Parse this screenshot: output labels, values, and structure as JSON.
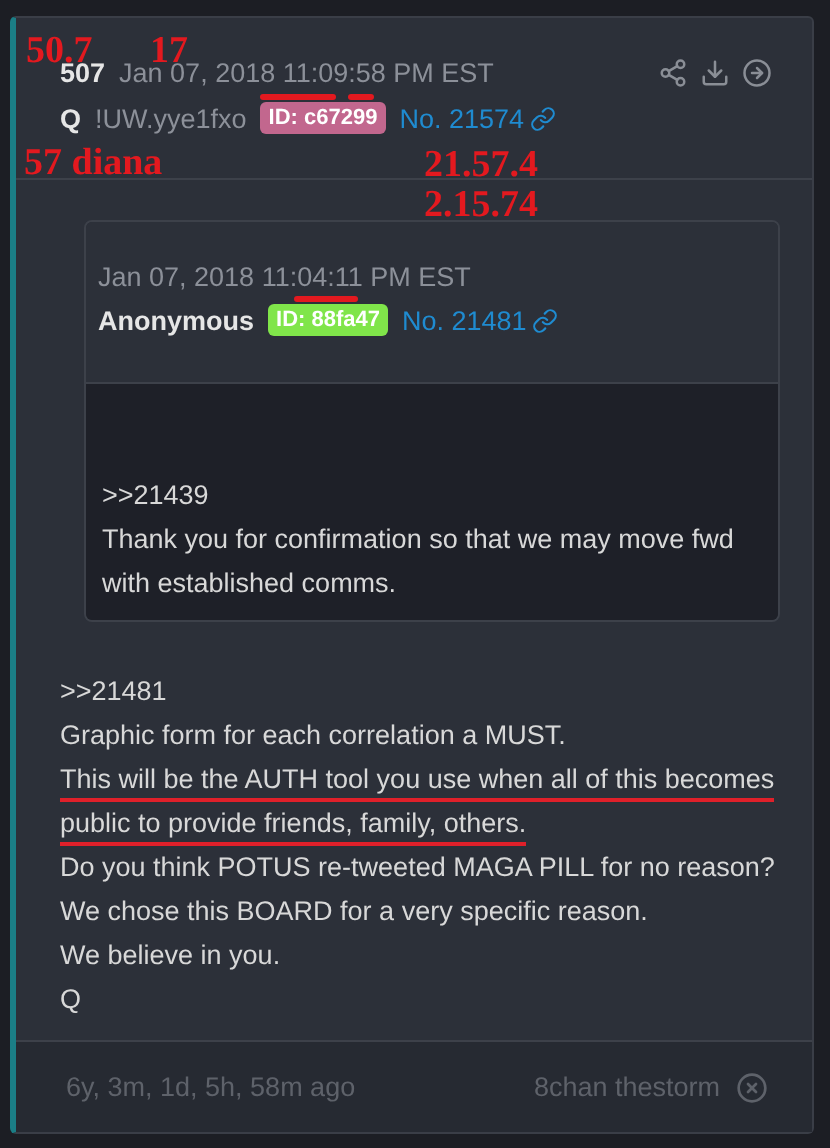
{
  "post": {
    "count": "507",
    "date": "Jan 07, 2018 11:09:58 PM EST",
    "author": "Q",
    "tripcode": "!UW.yye1fxo",
    "id_badge": {
      "text": "ID: c67299",
      "color": "#c2678e"
    },
    "number": "No. 21574",
    "quote": {
      "date": "Jan 07, 2018 11:04:11 PM EST",
      "author": "Anonymous",
      "id_badge": {
        "text": "ID: 88fa47",
        "color": "#80e54a"
      },
      "number": "No. 21481",
      "lines": [
        {
          "text": ">>21439"
        },
        {
          "text": "Thank you for confirmation so that we may move fwd with established comms."
        }
      ]
    },
    "lines": [
      {
        "text": ">>21481",
        "underlined": false
      },
      {
        "text": "Graphic form for each correlation a MUST.",
        "underlined": false
      },
      {
        "text": "This will be the AUTH tool you use when all of this becomes",
        "underlined": true
      },
      {
        "text": "public to provide friends, family, others.",
        "underlined": true
      },
      {
        "text": "Do you think POTUS re-tweeted MAGA PILL for no reason?",
        "underlined": false
      },
      {
        "text": "We chose this BOARD for a very specific reason.",
        "underlined": false
      },
      {
        "text": "We believe in you.",
        "underlined": false
      },
      {
        "text": "Q",
        "underlined": false
      }
    ],
    "age": "6y, 3m, 1d, 5h, 58m ago",
    "source": "8chan thestorm"
  },
  "annotations": [
    {
      "kind": "text",
      "text": "50.7"
    },
    {
      "kind": "text",
      "text": "17"
    },
    {
      "kind": "text",
      "text": "57 diana"
    },
    {
      "kind": "text",
      "text": "21.57.4"
    },
    {
      "kind": "text",
      "text": "2.15.74"
    },
    {
      "kind": "underline"
    },
    {
      "kind": "underline"
    },
    {
      "kind": "underline"
    }
  ]
}
